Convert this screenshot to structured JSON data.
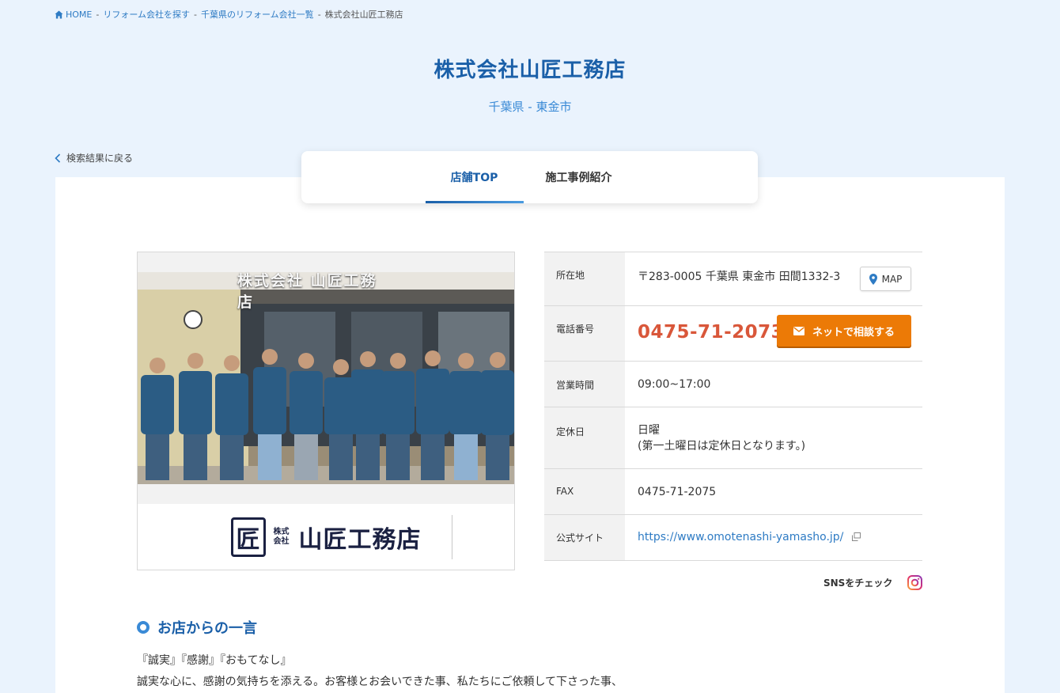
{
  "breadcrumb": {
    "home": "HOME",
    "items": [
      "リフォーム会社を探す",
      "千葉県のリフォーム会社一覧"
    ],
    "current": "株式会社山匠工務店",
    "separator": "-"
  },
  "header": {
    "title": "株式会社山匠工務店",
    "subtitle": "千葉県 - 東金市"
  },
  "back_link": "検索結果に戻る",
  "tabs": [
    {
      "label": "店舗TOP",
      "active": true
    },
    {
      "label": "施工事例紹介",
      "active": false
    }
  ],
  "photo": {
    "sign_text": "株式会社 山匠工務店",
    "logo_text_small": "株式会社",
    "logo_text_main": "山匠工務店",
    "logo_mark": "匠"
  },
  "info": {
    "address_label": "所在地",
    "address_value": "〒283-0005 千葉県 東金市 田間1332-3",
    "map_button": "MAP",
    "phone_label": "電話番号",
    "phone_value": "0475-71-2073",
    "contact_button": "ネットで相談する",
    "hours_label": "営業時間",
    "hours_value": "09:00~17:00",
    "holiday_label": "定休日",
    "holiday_value_line1": "日曜",
    "holiday_value_line2": "(第一土曜日は定休日となります。)",
    "fax_label": "FAX",
    "fax_value": "0475-71-2075",
    "site_label": "公式サイト",
    "site_value": "https://www.omotenashi-yamasho.jp/"
  },
  "sns": {
    "label": "SNSをチェック",
    "icon": "instagram-icon"
  },
  "message": {
    "heading": "お店からの一言",
    "line1": "『誠実』『感謝』『おもてなし』",
    "line2": "誠実な心に、感謝の気持ちを添える。お客様とお会いできた事、私たちにご依頼して下さった事、"
  },
  "colors": {
    "page_bg": "#eaf3fd",
    "brand_blue": "#1a5fa8",
    "link_blue": "#2e7bc4",
    "phone_red": "#d9573a",
    "contact_orange": "#ec7a06"
  }
}
